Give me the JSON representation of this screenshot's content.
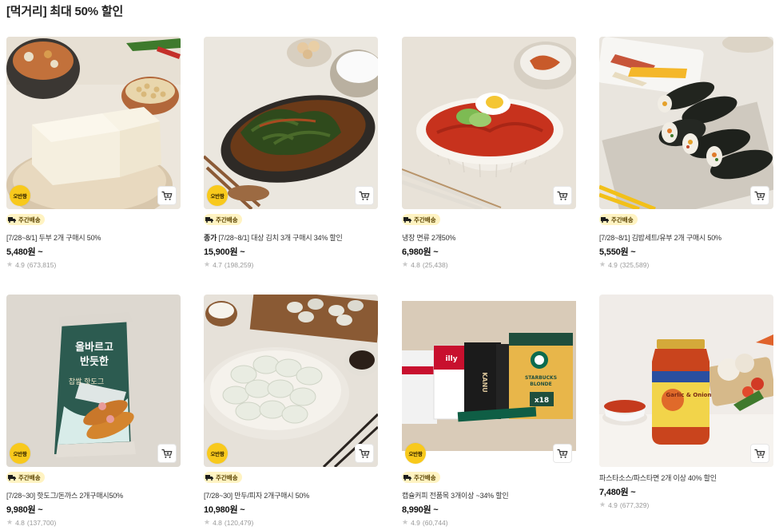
{
  "section": {
    "title": "[먹거리] 최대 50% 할인"
  },
  "badges": {
    "round_label": "오반짱",
    "delivery_label": "주간배송"
  },
  "products": [
    {
      "brand": "",
      "name": "[7/28~8/1] 두부 2개 구매시 50%",
      "price": "5,480원 ~",
      "rating": "4.9",
      "reviews": "(673,815)",
      "has_round_badge": true,
      "has_delivery": true
    },
    {
      "brand": "종가",
      "name": "[7/28~8/1] 대상 김치 3개 구매시 34% 할인",
      "price": "15,900원 ~",
      "rating": "4.7",
      "reviews": "(198,259)",
      "has_round_badge": true,
      "has_delivery": true
    },
    {
      "brand": "",
      "name": "냉장 면류 2개50%",
      "price": "6,980원 ~",
      "rating": "4.8",
      "reviews": "(25,438)",
      "has_round_badge": false,
      "has_delivery": true
    },
    {
      "brand": "",
      "name": "[7/28~8/1] 김밥세트/유부 2개 구매시 50%",
      "price": "5,550원 ~",
      "rating": "4.9",
      "reviews": "(325,589)",
      "has_round_badge": false,
      "has_delivery": true
    },
    {
      "brand": "",
      "name": "[7/28~30] 핫도그/돈까스 2개구매시50%",
      "price": "9,980원 ~",
      "rating": "4.8",
      "reviews": "(137,700)",
      "has_round_badge": true,
      "has_delivery": true
    },
    {
      "brand": "",
      "name": "[7/28~30] 만두/피자 2개구매시 50%",
      "price": "10,980원 ~",
      "rating": "4.8",
      "reviews": "(120,479)",
      "has_round_badge": true,
      "has_delivery": true
    },
    {
      "brand": "",
      "name": "캡슐커피 전품목 3개이상 ~34% 할인",
      "price": "8,990원 ~",
      "rating": "4.9",
      "reviews": "(60,744)",
      "has_round_badge": true,
      "has_delivery": true
    },
    {
      "brand": "",
      "name": "파스타소스/파스타면 2개 이상 40% 할인",
      "price": "7,480원 ~",
      "rating": "4.9",
      "reviews": "(677,329)",
      "has_round_badge": false,
      "has_delivery": false
    }
  ],
  "package_text": {
    "hotdog_brand_line1": "올바르고",
    "hotdog_brand_line2": "반듯한",
    "hotdog_product": "찹쌀 핫도그",
    "coffee_brand": "KANU",
    "coffee_brand2": "illy",
    "coffee_starbucks": "STARBUCKS",
    "coffee_blonde": "BLONDE",
    "coffee_count": "x18",
    "sauce_brand": "Garlic & Onion"
  },
  "colors": {
    "badge_yellow": "#f8c91c",
    "delivery_bg": "#fff3c2",
    "star": "#c8c8c8",
    "text_muted": "#999999"
  }
}
